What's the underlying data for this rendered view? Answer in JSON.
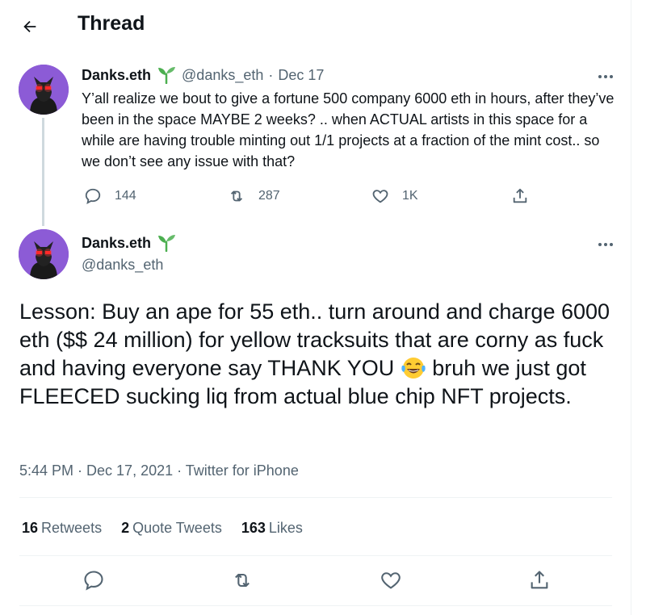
{
  "header": {
    "title": "Thread",
    "back_icon": "arrow-left-icon"
  },
  "tweet_parent": {
    "name": "Danks.eth",
    "badge_icon": "sprout-icon",
    "handle": "@danks_eth",
    "separator": "·",
    "date": "Dec 17",
    "text": "Y’all realize we bout to give a fortune 500 company 6000 eth in hours, after they’ve been in the space MAYBE 2 weeks? .. when ACTUAL artists in this space for a while are having trouble minting out 1/1 projects at a fraction of the mint cost.. so we don’t see any issue with that?",
    "replies": "144",
    "retweets": "287",
    "likes": "1K"
  },
  "tweet_main": {
    "name": "Danks.eth",
    "badge_icon": "sprout-icon",
    "handle": "@danks_eth",
    "text_part1": "Lesson: Buy an ape for 55 eth.. turn around and charge 6000 eth ($$ 24 million) for yellow tracksuits that are corny as fuck and having everyone say THANK YOU ",
    "emoji": "face-with-tears-of-joy-icon",
    "text_part2": " bruh we just got FLEECED sucking liq from actual blue chip NFT projects.",
    "timestamp": "5:44 PM · Dec 17, 2021 · Twitter for iPhone",
    "stats": [
      {
        "count": "16",
        "label": "Retweets"
      },
      {
        "count": "2",
        "label": "Quote Tweets"
      },
      {
        "count": "163",
        "label": "Likes"
      }
    ]
  },
  "colors": {
    "text": "#0f1419",
    "secondary": "#536471",
    "avatar_bg": "#8c5bd6",
    "sprout": "#4caf50",
    "border": "#eff3f4"
  }
}
